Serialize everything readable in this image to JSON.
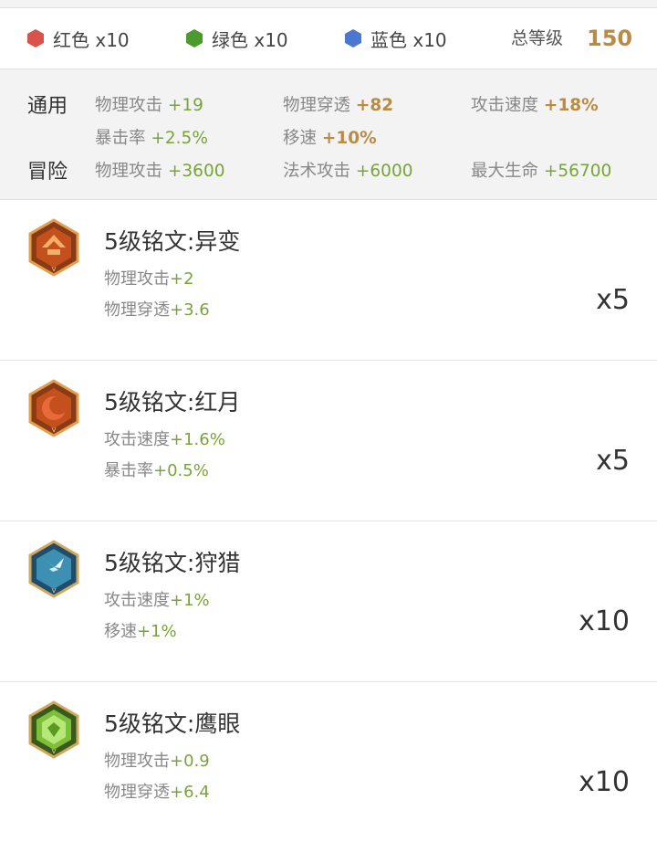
{
  "summary": {
    "colors": [
      {
        "label": "红色 x10",
        "icon": "red-hexagon-icon",
        "color": "#d9534a"
      },
      {
        "label": "绿色 x10",
        "icon": "green-hexagon-icon",
        "color": "#4a9a2e"
      },
      {
        "label": "蓝色 x10",
        "icon": "blue-hexagon-icon",
        "color": "#4a78d0"
      }
    ],
    "total_label": "总等级",
    "total_value": "150"
  },
  "stats": {
    "general": {
      "label": "通用",
      "items": [
        {
          "name": "物理攻击",
          "value": "+19"
        },
        {
          "name": "物理穿透",
          "value": "+82"
        },
        {
          "name": "攻击速度",
          "value": "+18%"
        },
        {
          "name": "暴击率",
          "value": "+2.5%"
        },
        {
          "name": "移速",
          "value": "+10%"
        }
      ]
    },
    "adventure": {
      "label": "冒险",
      "items": [
        {
          "name": "物理攻击",
          "value": "+3600"
        },
        {
          "name": "法术攻击",
          "value": "+6000"
        },
        {
          "name": "最大生命",
          "value": "+56700"
        }
      ]
    }
  },
  "runes": [
    {
      "title": "5级铭文:异变",
      "icon": "rune-mutation-icon",
      "count": "x5",
      "stats": [
        {
          "name": "物理攻击",
          "value": "+2"
        },
        {
          "name": "物理穿透",
          "value": "+3.6"
        }
      ]
    },
    {
      "title": "5级铭文:红月",
      "icon": "rune-red-moon-icon",
      "count": "x5",
      "stats": [
        {
          "name": "攻击速度",
          "value": "+1.6%"
        },
        {
          "name": "暴击率",
          "value": "+0.5%"
        }
      ]
    },
    {
      "title": "5级铭文:狩猎",
      "icon": "rune-hunt-icon",
      "count": "x10",
      "stats": [
        {
          "name": "攻击速度",
          "value": "+1%"
        },
        {
          "name": "移速",
          "value": "+1%"
        }
      ]
    },
    {
      "title": "5级铭文:鹰眼",
      "icon": "rune-hawk-eye-icon",
      "count": "x10",
      "stats": [
        {
          "name": "物理攻击",
          "value": "+0.9"
        },
        {
          "name": "物理穿透",
          "value": "+6.4"
        }
      ]
    }
  ]
}
